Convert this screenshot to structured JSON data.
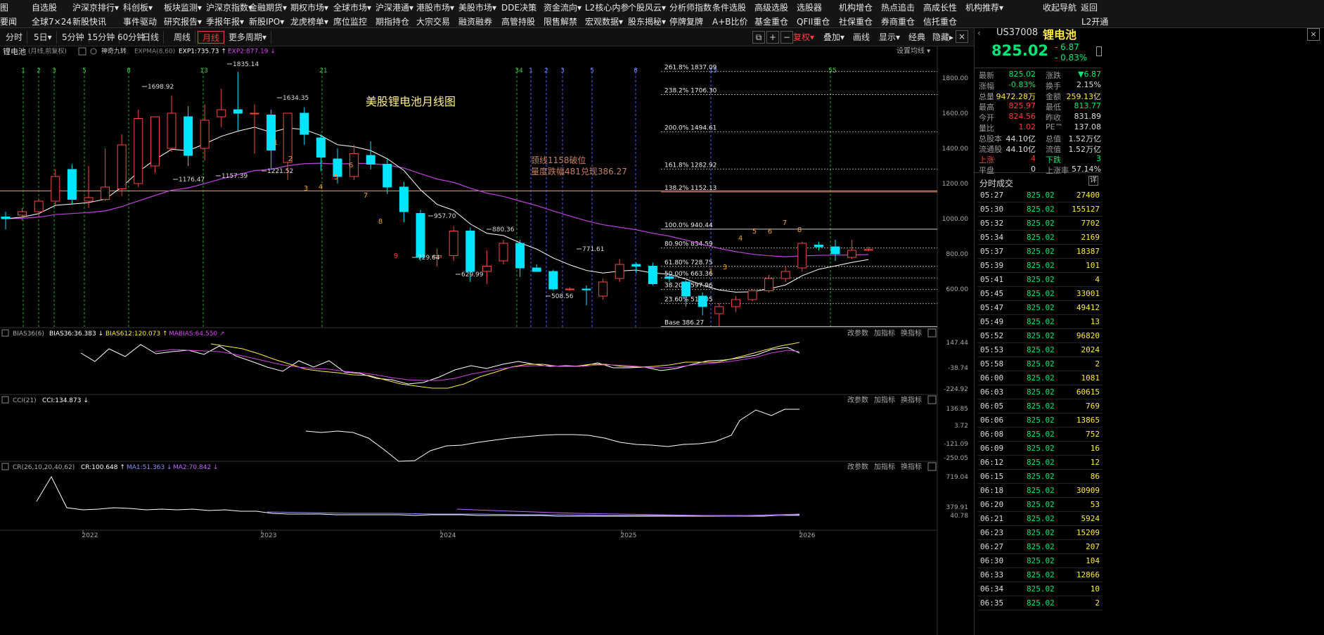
{
  "menu": {
    "row1": [
      "图",
      "自选股",
      "沪深京排行▾",
      "科创板▾",
      "板块监测▾",
      "沪深京指数▾",
      "金融期货▾",
      "期权市场▾",
      "全球市场▾",
      "沪深港通▾",
      "港股市场▾",
      "美股市场▾",
      "DDE决策",
      "资金流向▾",
      "L2核心内参",
      "个股风云▾",
      "分析师指数",
      "条件选股",
      "高级选股",
      "选股器",
      "机构增仓",
      "热点追击",
      "高成长性",
      "机构推荐▾",
      "收起导航",
      "返回"
    ],
    "row2": [
      "要闻",
      "全球7×24",
      "新股快讯",
      "事件驱动",
      "研究报告▾",
      "季报年报▾",
      "新股IPO▾",
      "龙虎榜单▾",
      "席位监控",
      "期指持仓",
      "大宗交易",
      "融资融券",
      "高管持股",
      "限售解禁",
      "宏观数据▾",
      "股东揭秘▾",
      "停牌复牌",
      "A+B比价",
      "基金重仓",
      "QFII重仓",
      "社保重仓",
      "券商重仓",
      "信托重仓",
      "L2开通"
    ]
  },
  "toolbar": {
    "periods": [
      "分时",
      "5日▾",
      "5分钟",
      "15分钟",
      "60分钟",
      "日线",
      "周线",
      "月线",
      "更多周期▾"
    ],
    "active": "月线",
    "right": [
      "复权▾",
      "叠加▾",
      "画线",
      "显示▾",
      "经典",
      "隐藏▸"
    ]
  },
  "chart_header": {
    "name": "锂电池",
    "meta": "(月线,前复权)",
    "indicator1": "神奇九转",
    "exp_label": "EXPMA(8,60)",
    "exp1": "EXP1:735.73 ↑",
    "exp2": "EXP2:877.19 ↓",
    "settings": "设置均线 ▾"
  },
  "annotations": {
    "title": "美股锂电池月线图",
    "neck1": "颈线1158破位",
    "neck2": "量度跌幅481兑现386.27",
    "peak": "1835.14",
    "p1698": "1698.92",
    "p1634": "1634.35",
    "p1176": "1176.47",
    "p1157": "1157.39",
    "p1221": "1221.52",
    "p957": "957.70",
    "p880": "880.36",
    "p729": "729.64",
    "p629": "629.99",
    "p771": "771.61",
    "p508": "508.56",
    "fib": [
      "261.8% 1837.09",
      "238.2% 1706.30",
      "200.0% 1494.61",
      "161.8% 1282.92",
      "138.2% 1152.13",
      "100.0% 940.44",
      "80.90% 834.59",
      "61.80% 728.75",
      "50.00% 663.36",
      "38.20% 597.96",
      "23.60% 517.05",
      "Base 386.27"
    ],
    "fib_counts": [
      "1",
      "2",
      "3",
      "5",
      "8",
      "13",
      "21",
      "34",
      "1",
      "2",
      "3",
      "5",
      "8",
      "13",
      "55"
    ]
  },
  "yaxis_main": [
    "1800.00",
    "1600.00",
    "1400.00",
    "1200.00",
    "1000.00",
    "800.00",
    "600.00"
  ],
  "xaxis": [
    "2022",
    "2023",
    "2024",
    "2025",
    "2026"
  ],
  "bias": {
    "label": "BIAS36(6)",
    "v1": "BIAS36:36.383 ↓",
    "v2": "BIAS612:120.073 ↑",
    "v3": "MABIAS:64.550 ↗",
    "ticks": [
      "147.44",
      "-38.74",
      "-224.92"
    ]
  },
  "cci": {
    "label": "CCI(21)",
    "v1": "CCI:134.873 ↓",
    "ticks": [
      "136.85",
      "3.72",
      "-121.09",
      "-250.05"
    ]
  },
  "cr": {
    "label": "CR(26,10,20,40,62)",
    "v1": "CR:100.648 ↑",
    "v2": "MA1:51.363 ↓",
    "v3": "MA2:70.842 ↓",
    "ticks": [
      "719.04",
      "379.91",
      "40.78"
    ]
  },
  "panel_buttons": [
    "改参数",
    "加指标",
    "换指标"
  ],
  "quote": {
    "code": "US37008",
    "name": "锂电池",
    "price": "825.02",
    "chg": "- 6.87",
    "pct": "- 0.83%",
    "rows": [
      [
        "最新",
        "825.02",
        "涨跌",
        "▼6.87"
      ],
      [
        "涨幅",
        "-0.83%",
        "换手",
        "2.15%"
      ],
      [
        "总量",
        "9472.28万",
        "金额",
        "259.13亿"
      ],
      [
        "最高",
        "825.97",
        "最低",
        "813.77"
      ],
      [
        "今开",
        "824.56",
        "昨收",
        "831.89"
      ],
      [
        "量比",
        "1.02",
        "PE™",
        "137.08"
      ],
      [
        "总股本",
        "44.10亿",
        "总值",
        "1.52万亿"
      ],
      [
        "流通股",
        "44.10亿",
        "流值",
        "1.52万亿"
      ],
      [
        "上涨",
        "4",
        "下跌",
        "3"
      ],
      [
        "平盘",
        "0",
        "上涨率",
        "57.14%"
      ]
    ]
  },
  "ticks_header": {
    "title": "分时成交",
    "detail": "详"
  },
  "ticks": [
    [
      "05:27",
      "825.02",
      "27400"
    ],
    [
      "05:30",
      "825.02",
      "155127"
    ],
    [
      "05:32",
      "825.02",
      "7702"
    ],
    [
      "05:34",
      "825.02",
      "2169"
    ],
    [
      "05:37",
      "825.02",
      "18387"
    ],
    [
      "05:39",
      "825.02",
      "101"
    ],
    [
      "05:41",
      "825.02",
      "4"
    ],
    [
      "05:45",
      "825.02",
      "33001"
    ],
    [
      "05:47",
      "825.02",
      "49412"
    ],
    [
      "05:49",
      "825.02",
      "13"
    ],
    [
      "05:52",
      "825.02",
      "96820"
    ],
    [
      "05:53",
      "825.02",
      "2024"
    ],
    [
      "05:58",
      "825.02",
      "2"
    ],
    [
      "06:00",
      "825.02",
      "1081"
    ],
    [
      "06:03",
      "825.02",
      "60615"
    ],
    [
      "06:05",
      "825.02",
      "769"
    ],
    [
      "06:06",
      "825.02",
      "13865"
    ],
    [
      "06:08",
      "825.02",
      "752"
    ],
    [
      "06:09",
      "825.02",
      "16"
    ],
    [
      "06:12",
      "825.02",
      "12"
    ],
    [
      "06:15",
      "825.02",
      "86"
    ],
    [
      "06:18",
      "825.02",
      "30909"
    ],
    [
      "06:20",
      "825.02",
      "53"
    ],
    [
      "06:21",
      "825.02",
      "5924"
    ],
    [
      "06:23",
      "825.02",
      "15209"
    ],
    [
      "06:27",
      "825.02",
      "207"
    ],
    [
      "06:30",
      "825.02",
      "104"
    ],
    [
      "06:33",
      "825.02",
      "12866"
    ],
    [
      "06:34",
      "825.02",
      "10"
    ],
    [
      "06:35",
      "825.02",
      "2"
    ]
  ],
  "chart_data": {
    "type": "candlestick",
    "title": "美股锂电池月线图",
    "ylim": [
      380,
      1900
    ],
    "series": [
      {
        "name": "K",
        "ohlc": [
          [
            1010,
            1040,
            940,
            1000
          ],
          [
            1020,
            1060,
            990,
            1040
          ],
          [
            1040,
            1110,
            1010,
            1100
          ],
          [
            1100,
            1280,
            1080,
            1240
          ],
          [
            1280,
            1310,
            1080,
            1110
          ],
          [
            1100,
            1300,
            1060,
            1120
          ],
          [
            1110,
            1400,
            1100,
            1180
          ],
          [
            1170,
            1480,
            1130,
            1420
          ],
          [
            1200,
            1620,
            1180,
            1570
          ],
          [
            1300,
            1580,
            1260,
            1580
          ],
          [
            1400,
            1700,
            1380,
            1600
          ],
          [
            1580,
            1640,
            1300,
            1360
          ],
          [
            1400,
            1650,
            1330,
            1560
          ],
          [
            1580,
            1740,
            1520,
            1620
          ],
          [
            1620,
            1835,
            1500,
            1600
          ],
          [
            1600,
            1650,
            1370,
            1600
          ],
          [
            1590,
            1620,
            1280,
            1390
          ],
          [
            1320,
            1600,
            1221,
            1600
          ],
          [
            1600,
            1634,
            1420,
            1480
          ],
          [
            1460,
            1480,
            1270,
            1350
          ],
          [
            1340,
            1400,
            1200,
            1240
          ],
          [
            1240,
            1420,
            1220,
            1370
          ],
          [
            1360,
            1440,
            1280,
            1310
          ],
          [
            1310,
            1340,
            1140,
            1180
          ],
          [
            1180,
            1210,
            980,
            1040
          ],
          [
            1030,
            1050,
            760,
            780
          ],
          [
            780,
            830,
            729,
            790
          ],
          [
            790,
            957,
            760,
            930
          ],
          [
            930,
            950,
            640,
            700
          ],
          [
            700,
            820,
            629,
            730
          ],
          [
            760,
            880,
            740,
            860
          ],
          [
            860,
            880,
            670,
            720
          ],
          [
            720,
            740,
            710,
            700
          ],
          [
            700,
            710,
            590,
            600
          ],
          [
            600,
            610,
            590,
            600
          ],
          [
            600,
            620,
            508,
            595
          ],
          [
            560,
            660,
            540,
            640
          ],
          [
            660,
            771,
            640,
            740
          ],
          [
            740,
            750,
            690,
            730
          ],
          [
            730,
            750,
            620,
            630
          ],
          [
            670,
            690,
            640,
            660
          ],
          [
            640,
            650,
            500,
            560
          ],
          [
            560,
            580,
            450,
            500
          ],
          [
            460,
            520,
            386,
            500
          ],
          [
            500,
            560,
            470,
            540
          ],
          [
            540,
            600,
            530,
            590
          ],
          [
            590,
            680,
            580,
            660
          ],
          [
            660,
            730,
            640,
            700
          ],
          [
            720,
            870,
            700,
            860
          ],
          [
            850,
            870,
            820,
            840
          ],
          [
            840,
            880,
            760,
            800
          ],
          [
            780,
            880,
            770,
            820
          ],
          [
            820,
            840,
            814,
            825
          ]
        ]
      }
    ]
  }
}
